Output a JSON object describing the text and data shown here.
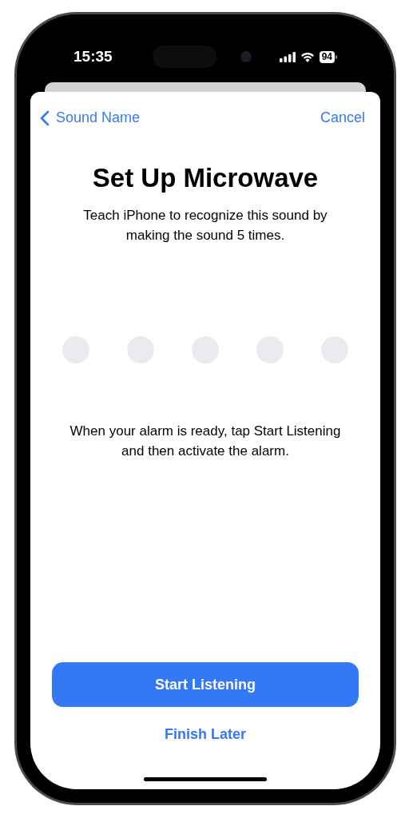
{
  "status_bar": {
    "time": "15:35",
    "battery": "94"
  },
  "nav": {
    "back": "Sound Name",
    "cancel": "Cancel"
  },
  "title": "Set Up Microwave",
  "subtitle": "Teach iPhone to recognize this sound by making the sound 5 times.",
  "progress_dots": [
    {
      "filled": false
    },
    {
      "filled": false
    },
    {
      "filled": false
    },
    {
      "filled": false
    },
    {
      "filled": false
    }
  ],
  "instruction": "When your alarm is ready, tap Start Listening and then activate the alarm.",
  "primary_button": "Start Listening",
  "secondary_button": "Finish Later"
}
